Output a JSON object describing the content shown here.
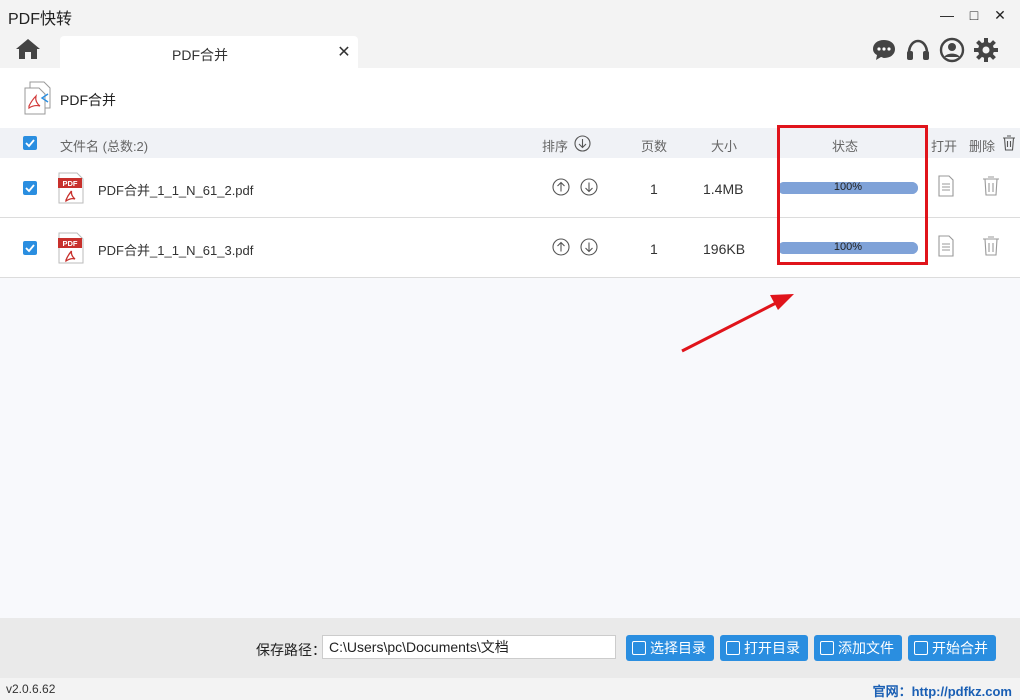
{
  "window": {
    "title": "PDF快转",
    "min_glyph": "—",
    "max_glyph": "□",
    "close_glyph": "✕"
  },
  "tabs": [
    {
      "label": "PDF合并",
      "close_glyph": "✕"
    }
  ],
  "tool": {
    "title": "PDF合并"
  },
  "table": {
    "headers": {
      "filename": "文件名 (总数:2)",
      "sort": "排序",
      "pages": "页数",
      "size": "大小",
      "status": "状态",
      "open": "打开",
      "delete": "删除"
    },
    "rows": [
      {
        "filename": "PDF合并_1_1_N_61_2.pdf",
        "pages": "1",
        "size": "1.4MB",
        "progress_text": "100%",
        "progress": 1.0
      },
      {
        "filename": "PDF合并_1_1_N_61_3.pdf",
        "pages": "1",
        "size": "196KB",
        "progress_text": "100%",
        "progress": 1.0
      }
    ]
  },
  "bottom": {
    "save_label": "保存路径：",
    "save_path": "C:\\Users\\pc\\Documents\\文档",
    "buttons": {
      "choose_dir": "选择目录",
      "open_dir": "打开目录",
      "add_file": "添加文件",
      "start_merge": "开始合并"
    }
  },
  "status": {
    "version": "v2.0.6.62",
    "site": "官网：http://pdfkz.com"
  },
  "colors": {
    "accent": "#2a8ee0",
    "progress": "#8aaee0",
    "annotation": "#e0141b",
    "pdf_red": "#c8302c"
  },
  "icons": [
    "home-icon",
    "chat-icon",
    "headset-icon",
    "user-icon",
    "gear-icon",
    "pdf-file-icon",
    "arrow-up-icon",
    "arrow-down-icon",
    "document-icon",
    "trash-icon"
  ]
}
